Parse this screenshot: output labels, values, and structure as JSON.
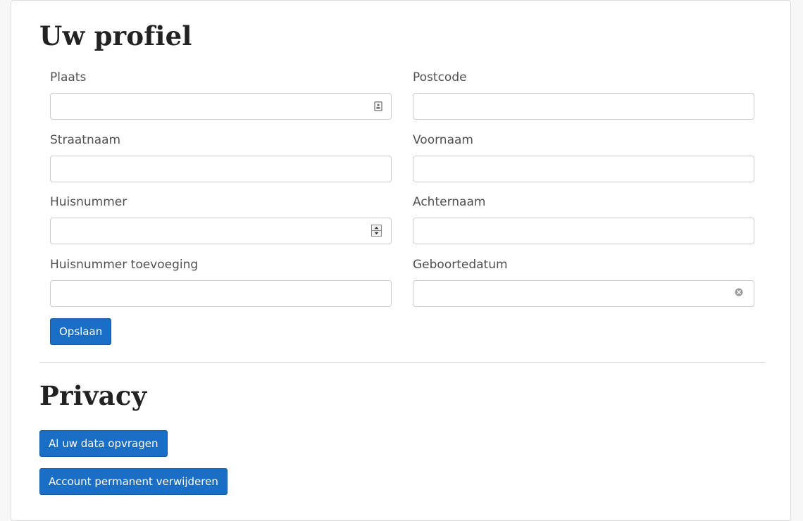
{
  "profile": {
    "title": "Uw profiel",
    "fields": {
      "plaats": {
        "label": "Plaats",
        "value": ""
      },
      "postcode": {
        "label": "Postcode",
        "value": ""
      },
      "straatnaam": {
        "label": "Straatnaam",
        "value": ""
      },
      "voornaam": {
        "label": "Voornaam",
        "value": ""
      },
      "huisnummer": {
        "label": "Huisnummer",
        "value": ""
      },
      "achternaam": {
        "label": "Achternaam",
        "value": ""
      },
      "toevoeging": {
        "label": "Huisnummer toevoeging",
        "value": ""
      },
      "geboortedatum": {
        "label": "Geboortedatum",
        "value": ""
      }
    },
    "save_label": "Opslaan"
  },
  "privacy": {
    "title": "Privacy",
    "request_data_label": "Al uw data opvragen",
    "delete_account_label": "Account permanent verwijderen"
  },
  "icons": {
    "plaats_field_icon": "contact-card-icon",
    "huisnummer_field_icon": "spinner-arrows-icon",
    "geboortedatum_field_icon": "clear-icon"
  },
  "colors": {
    "primary_button": "#1a6ec5",
    "heading": "#222222",
    "label": "#505050"
  }
}
